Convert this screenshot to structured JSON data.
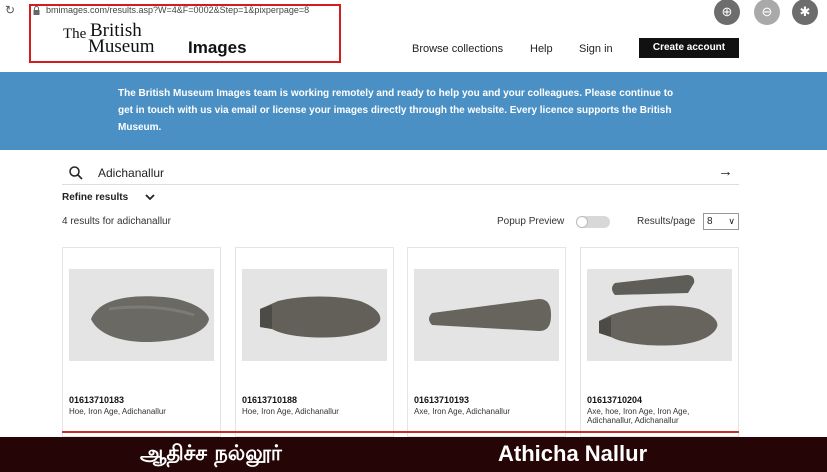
{
  "browser": {
    "url": "bmimages.com/results.asp?W=4&F=0002&Step=1&pixperpage=8"
  },
  "header": {
    "logo_the": "The",
    "logo_british": "British",
    "logo_museum": "Museum",
    "logo_images": "Images",
    "nav": [
      "Browse collections",
      "Help",
      "Sign in"
    ],
    "create_account": "Create account"
  },
  "banner": {
    "text": "The British Museum Images team is working remotely and ready to help you and your colleagues.  Please continue to get in touch with us via email or license your images directly through the website.  Every licence supports the British Museum."
  },
  "search": {
    "value": "Adichanallur"
  },
  "refine": {
    "label": "Refine results"
  },
  "results": {
    "count_text": "4 results for adichanallur",
    "popup_preview_label": "Popup Preview",
    "popup_preview_on": false,
    "per_page_label": "Results/page",
    "per_page_value": "8"
  },
  "cards": [
    {
      "number": "01613710183",
      "description": "Hoe, Iron Age, Adichanallur"
    },
    {
      "number": "01613710188",
      "description": "Hoe, Iron Age, Adichanallur"
    },
    {
      "number": "01613710193",
      "description": "Axe, Iron Age, Adichanallur"
    },
    {
      "number": "01613710204",
      "description": "Axe, hoe, Iron Age, Iron Age, Adichanallur, Adichanallur"
    }
  ],
  "caption": {
    "tamil": "ஆதிச்ச நல்லூர்",
    "english": "Athicha Nallur"
  },
  "colors": {
    "banner": "#4b90c4",
    "highlight_red": "#d31c1c",
    "caption_bg": "#250505"
  }
}
